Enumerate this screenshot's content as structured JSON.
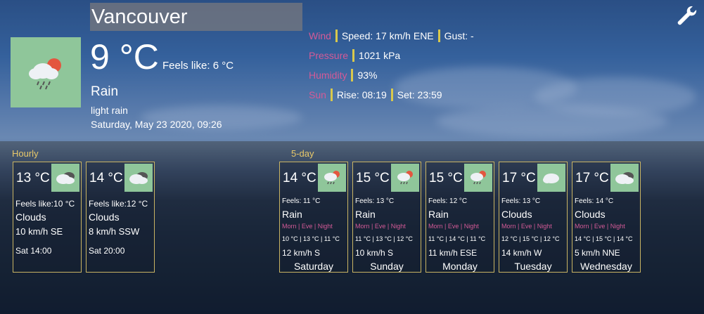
{
  "location": {
    "city": "Vancouver"
  },
  "current": {
    "temperature": "9 °C",
    "feels_like": "Feels like: 6 °C",
    "condition": "Rain",
    "description": "light rain",
    "datetime": "Saturday, May 23 2020, 09:26",
    "icon": "rain-cloud-sun-icon"
  },
  "details": {
    "wind_label": "Wind",
    "wind_speed": "Speed: 17 km/h ENE",
    "wind_gust": "Gust: -",
    "pressure_label": "Pressure",
    "pressure_value": "1021 kPa",
    "humidity_label": "Humidity",
    "humidity_value": "93%",
    "sun_label": "Sun",
    "sunrise": "Rise: 08:19",
    "sunset": "Set: 23:59"
  },
  "sections": {
    "hourly": "Hourly",
    "fiveday": "5-day"
  },
  "hourly": [
    {
      "temp": "13 °C",
      "feels": "Feels like:10 °C",
      "condition": "Clouds",
      "wind": "10 km/h SE",
      "time": "Sat 14:00",
      "icon": "cloudy-icon"
    },
    {
      "temp": "14 °C",
      "feels": "Feels like:12 °C",
      "condition": "Clouds",
      "wind": "8 km/h SSW",
      "time": "Sat 20:00",
      "icon": "cloudy-icon"
    }
  ],
  "forecast_header": "Morn | Eve | Night",
  "forecast": [
    {
      "temp": "14 °C",
      "feels": "Feels: 11 °C",
      "condition": "Rain",
      "temps": "10 °C | 13 °C | 11 °C",
      "wind": "12 km/h S",
      "day": "Saturday",
      "icon": "rain-cloud-sun-icon"
    },
    {
      "temp": "15 °C",
      "feels": "Feels: 13 °C",
      "condition": "Rain",
      "temps": "11 °C | 13 °C | 12 °C",
      "wind": "10 km/h S",
      "day": "Sunday",
      "icon": "rain-cloud-sun-icon"
    },
    {
      "temp": "15 °C",
      "feels": "Feels: 12 °C",
      "condition": "Rain",
      "temps": "11 °C | 14 °C | 11 °C",
      "wind": "11 km/h ESE",
      "day": "Monday",
      "icon": "rain-cloud-sun-icon"
    },
    {
      "temp": "17 °C",
      "feels": "Feels: 13 °C",
      "condition": "Clouds",
      "temps": "12 °C | 15 °C | 12 °C",
      "wind": "14 km/h W",
      "day": "Tuesday",
      "icon": "cloud-icon"
    },
    {
      "temp": "17 °C",
      "feels": "Feels: 14 °C",
      "condition": "Clouds",
      "temps": "14 °C | 15 °C | 14 °C",
      "wind": "5 km/h NNE",
      "day": "Wednesday",
      "icon": "cloudy-icon"
    }
  ]
}
